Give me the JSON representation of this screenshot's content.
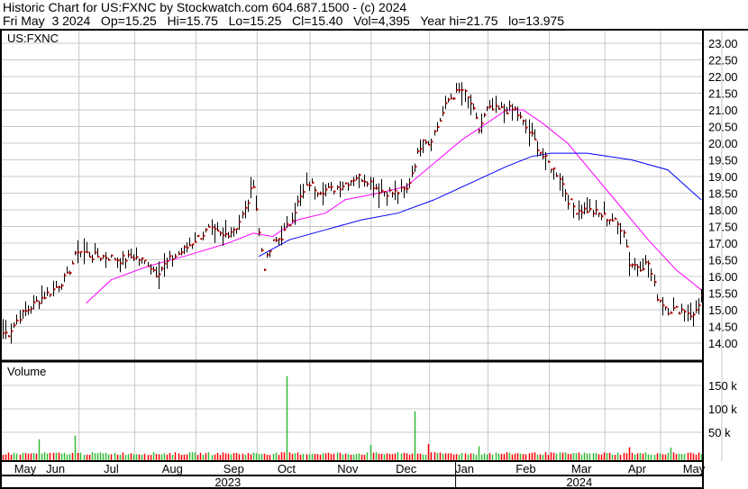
{
  "header": {
    "line1": "Historic Chart for US:FXNC by Stockwatch.com 604.687.1500 - (c) 2024",
    "line2": "Fri May  3 2024   Op=15.25   Hi=15.75   Lo=15.25   Cl=15.40   Vol=4,395   Year hi=21.75   lo=13.975"
  },
  "chart_data": {
    "type": "ohlc",
    "symbol_label": "US:FXNC",
    "volume_label": "Volume",
    "price_ylim": [
      13.6,
      23.3
    ],
    "price_ticks": [
      "23.00",
      "22.50",
      "22.00",
      "21.50",
      "21.00",
      "20.50",
      "20.00",
      "19.50",
      "19.00",
      "18.50",
      "18.00",
      "17.50",
      "17.00",
      "16.50",
      "16.00",
      "15.50",
      "15.00",
      "14.50",
      "14.00"
    ],
    "volume_ticks": [
      {
        "label": "150 k",
        "value": 150000
      },
      {
        "label": "100 k",
        "value": 100000
      },
      {
        "label": "50 k",
        "value": 50000
      }
    ],
    "volume_ylim": [
      0,
      190000
    ],
    "days_total": 252,
    "months": [
      {
        "label": "May",
        "day": 0
      },
      {
        "label": "Jun",
        "day": 19
      },
      {
        "label": "Jul",
        "day": 39
      },
      {
        "label": "Aug",
        "day": 61
      },
      {
        "label": "Sep",
        "day": 83
      },
      {
        "label": "Oct",
        "day": 102
      },
      {
        "label": "Nov",
        "day": 124
      },
      {
        "label": "Dec",
        "day": 145
      },
      {
        "label": "Jan",
        "day": 166
      },
      {
        "label": "Feb",
        "day": 188
      },
      {
        "label": "Mar",
        "day": 208
      },
      {
        "label": "Apr",
        "day": 228
      },
      {
        "label": "May",
        "day": 250
      }
    ],
    "years": [
      {
        "label": "2023",
        "start": 0,
        "end": 166
      },
      {
        "label": "2024",
        "start": 166,
        "end": 252
      }
    ],
    "bar_range": 0.35,
    "closes": [
      [
        2,
        14.3
      ],
      [
        6,
        14.8
      ],
      [
        13,
        15.3
      ],
      [
        18,
        15.6
      ],
      [
        23,
        16.0
      ],
      [
        27,
        16.8
      ],
      [
        32,
        16.6
      ],
      [
        37,
        16.6
      ],
      [
        42,
        16.5
      ],
      [
        47,
        16.6
      ],
      [
        52,
        16.4
      ],
      [
        55,
        16.1
      ],
      [
        60,
        16.5
      ],
      [
        65,
        16.8
      ],
      [
        69,
        17.1
      ],
      [
        74,
        17.4
      ],
      [
        79,
        17.2
      ],
      [
        84,
        17.5
      ],
      [
        87,
        18.0
      ],
      [
        90,
        18.8
      ],
      [
        92,
        17.3
      ],
      [
        94,
        16.3
      ],
      [
        97,
        17.0
      ],
      [
        100,
        17.2
      ],
      [
        103,
        17.6
      ],
      [
        106,
        18.2
      ],
      [
        110,
        18.8
      ],
      [
        113,
        18.6
      ],
      [
        118,
        18.6
      ],
      [
        123,
        18.8
      ],
      [
        127,
        19.0
      ],
      [
        131,
        18.9
      ],
      [
        135,
        18.6
      ],
      [
        140,
        18.5
      ],
      [
        145,
        18.6
      ],
      [
        148,
        19.4
      ],
      [
        151,
        20.2
      ],
      [
        153,
        20.0
      ],
      [
        156,
        20.5
      ],
      [
        160,
        21.3
      ],
      [
        163,
        21.5
      ],
      [
        165,
        21.6
      ],
      [
        168,
        21.2
      ],
      [
        171,
        20.4
      ],
      [
        174,
        21.0
      ],
      [
        177,
        21.0
      ],
      [
        181,
        21.0
      ],
      [
        184,
        21.0
      ],
      [
        187,
        20.6
      ],
      [
        190,
        20.2
      ],
      [
        194,
        19.6
      ],
      [
        197,
        19.3
      ],
      [
        200,
        19.0
      ],
      [
        203,
        18.3
      ],
      [
        206,
        18.0
      ],
      [
        210,
        18.0
      ],
      [
        213,
        17.9
      ],
      [
        216,
        17.8
      ],
      [
        219,
        17.7
      ],
      [
        223,
        17.4
      ],
      [
        225,
        16.4
      ],
      [
        229,
        16.3
      ],
      [
        232,
        16.4
      ],
      [
        235,
        15.4
      ],
      [
        239,
        15.0
      ],
      [
        242,
        15.0
      ],
      [
        245,
        15.0
      ],
      [
        248,
        14.8
      ],
      [
        251,
        15.4
      ]
    ],
    "ma_short": {
      "color": "#ff00ff",
      "points": [
        [
          30,
          15.2
        ],
        [
          39,
          15.9
        ],
        [
          52,
          16.3
        ],
        [
          65,
          16.6
        ],
        [
          81,
          17.0
        ],
        [
          90,
          17.3
        ],
        [
          97,
          17.2
        ],
        [
          106,
          17.7
        ],
        [
          116,
          17.9
        ],
        [
          123,
          18.3
        ],
        [
          135,
          18.5
        ],
        [
          145,
          18.7
        ],
        [
          155,
          19.4
        ],
        [
          165,
          20.1
        ],
        [
          174,
          20.6
        ],
        [
          181,
          21.0
        ],
        [
          187,
          21.0
        ],
        [
          194,
          20.6
        ],
        [
          203,
          20.0
        ],
        [
          213,
          19.0
        ],
        [
          223,
          18.0
        ],
        [
          232,
          17.1
        ],
        [
          242,
          16.2
        ],
        [
          251,
          15.6
        ]
      ]
    },
    "ma_long": {
      "color": "#0000ff",
      "points": [
        [
          92,
          16.6
        ],
        [
          103,
          17.1
        ],
        [
          116,
          17.4
        ],
        [
          129,
          17.7
        ],
        [
          142,
          17.9
        ],
        [
          155,
          18.3
        ],
        [
          168,
          18.8
        ],
        [
          181,
          19.3
        ],
        [
          190,
          19.6
        ],
        [
          197,
          19.7
        ],
        [
          210,
          19.7
        ],
        [
          226,
          19.5
        ],
        [
          239,
          19.2
        ],
        [
          251,
          18.3
        ]
      ]
    },
    "volume_spikes": [
      [
        13,
        35000,
        "up"
      ],
      [
        26,
        43000,
        "up"
      ],
      [
        102,
        170000,
        "up"
      ],
      [
        132,
        23000,
        "up"
      ],
      [
        148,
        95000,
        "up"
      ],
      [
        153,
        25000,
        "down"
      ],
      [
        171,
        20000,
        "up"
      ],
      [
        225,
        18000,
        "down"
      ],
      [
        240,
        17000,
        "up"
      ]
    ],
    "colors": {
      "up": "#33bb33",
      "down": "#ff0000",
      "bar": "#000000",
      "close_tick": "#cc0000",
      "grid": "#c8c8c8"
    }
  }
}
